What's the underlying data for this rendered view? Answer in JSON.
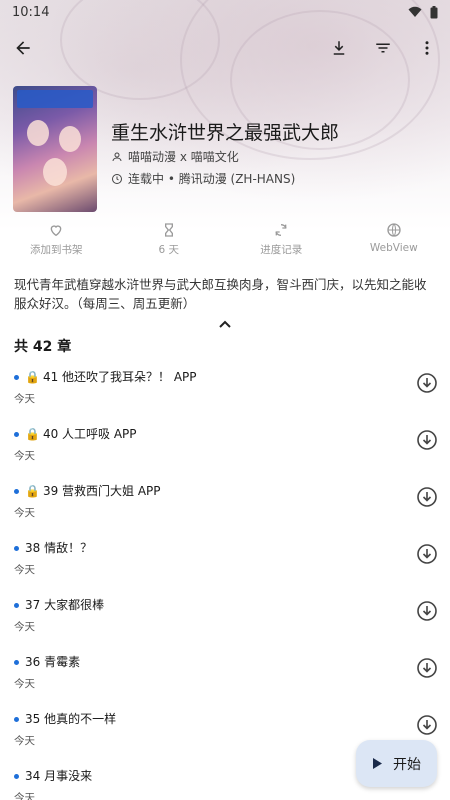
{
  "status": {
    "time": "10:14"
  },
  "manga": {
    "title": "重生水浒世界之最强武大郎",
    "author": "喵喵动漫 x 喵喵文化",
    "status_line": "连载中 • 腾讯动漫 (ZH-HANS)",
    "description": "现代青年武植穿越水浒世界与武大郎互换肉身，智斗西门庆，以先知之能收服众好汉。（每周三、周五更新）"
  },
  "actions": [
    {
      "label": "添加到书架",
      "icon": "heart-outline-icon"
    },
    {
      "label": "6 天",
      "icon": "hourglass-icon"
    },
    {
      "label": "进度记录",
      "icon": "sync-icon"
    },
    {
      "label": "WebView",
      "icon": "globe-icon"
    }
  ],
  "chapter_count": "共 42 章",
  "chapters": [
    {
      "title": "41 他还吹了我耳朵？！ APP",
      "date": "今天",
      "locked": true
    },
    {
      "title": "40 人工呼吸 APP",
      "date": "今天",
      "locked": true
    },
    {
      "title": "39 营救西门大姐 APP",
      "date": "今天",
      "locked": true
    },
    {
      "title": "38 情敌！？",
      "date": "今天",
      "locked": false
    },
    {
      "title": "37 大家都很棒",
      "date": "今天",
      "locked": false
    },
    {
      "title": "36 青霉素",
      "date": "今天",
      "locked": false
    },
    {
      "title": "35 他真的不一样",
      "date": "今天",
      "locked": false
    },
    {
      "title": "34 月事没来",
      "date": "今天",
      "locked": false
    }
  ],
  "fab": {
    "label": "开始"
  },
  "colors": {
    "accent": "#1e6fd9",
    "fab_bg": "#dce6f5"
  }
}
